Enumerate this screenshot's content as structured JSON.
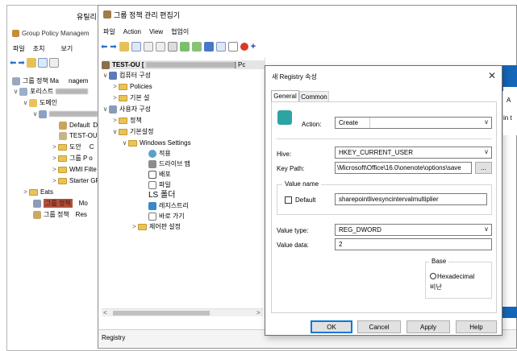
{
  "gpmc": {
    "title_prefix": "유틸리",
    "app_title": "Group Policy Managem",
    "menu": [
      "파일",
      "조치",
      "보기"
    ],
    "tree": {
      "root": "그룹 정책 Ma",
      "root_suffix": "nagem",
      "forest": "포리스트",
      "domains": "도메인",
      "default": "Default",
      "default_suffix": "D",
      "test_ou": "TEST-OU",
      "site_item": "도안",
      "site_suffix": "C",
      "gp_item": "그룹 P",
      "gp_suffix": "o",
      "wmi": "WMI Filte",
      "starter": "Starter GP",
      "eats": "Eats",
      "gp_results_label": "그룹 정책",
      "gp_results_suffix": "Mo",
      "gp_results2": "그룹 정책",
      "gp_results2_suffix": "Res"
    }
  },
  "editor": {
    "title": "그룹 정책 관리 편집기",
    "menu": [
      "파일",
      "Action",
      "View",
      "협업이"
    ],
    "tree": {
      "root": "TEST-OU [",
      "root_suffix": "] Pc",
      "computer_config": "컴퓨터 구성",
      "policies": "Policies",
      "preferences": "기본 설",
      "user_config": "사용자 구성",
      "user_policies": "정책",
      "user_prefs": "기본설정",
      "windows_settings": "Windows Settings",
      "env": "적용",
      "drive_maps": "드라이브 맵",
      "shortcuts": "배포",
      "files": "파일",
      "folders": "LS 폴더",
      "ini_files": "레지스트리",
      "shortcuts2": "바로 가기",
      "control_panel": "제어판 설정"
    },
    "status": "Registry"
  },
  "dialog": {
    "title": "새 Registry 속성",
    "tabs": [
      "General",
      "Common"
    ],
    "action_label": "Action:",
    "action_value": "Create",
    "hive_label": "Hive:",
    "hive_value": "HKEY_CURRENT_USER",
    "key_path_label": "Key Path:",
    "key_path_value": "\\Microsoft\\Office\\16.0\\onenote\\options\\save",
    "browse_label": "...",
    "value_name_group": "Value name",
    "default_label": "Default",
    "value_name_value": "sharepointlivesyncintervalmultiplier",
    "value_type_label": "Value type:",
    "value_type_value": "REG_DWORD",
    "value_data_label": "Value data:",
    "value_data_value": "2",
    "base_group": "Base",
    "hex_label": "Hexadecimal",
    "dec_label": "비난",
    "ok": "OK",
    "cancel": "Cancel",
    "apply": "Apply",
    "help": "Help"
  },
  "colors": {
    "accent": "#0078d7",
    "folder": "#e8c35a",
    "redaction": "#b0b0b0"
  }
}
